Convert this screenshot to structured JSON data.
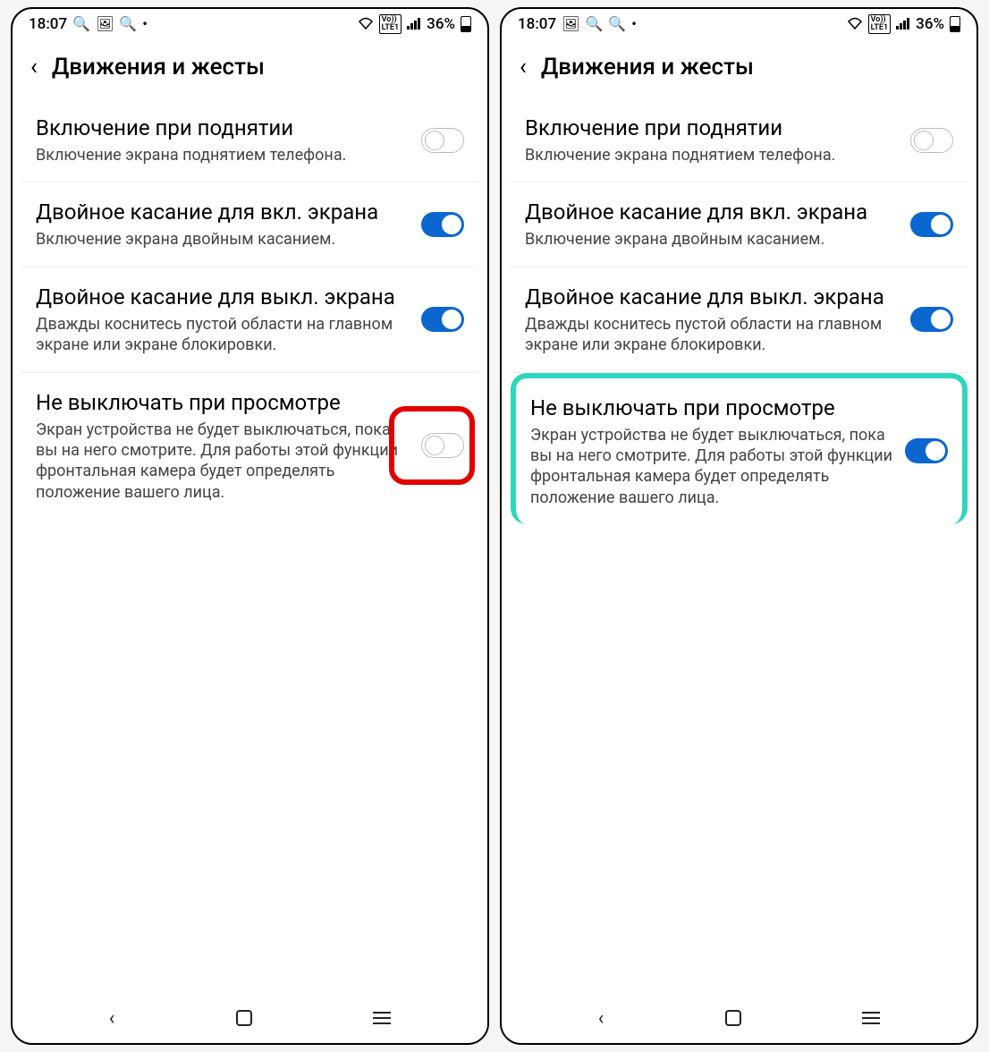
{
  "status": {
    "time": "18:07",
    "battery_pct": "36%",
    "icons_left": [
      "search",
      "image",
      "search",
      "dot"
    ],
    "icons_right": [
      "wifi",
      "volte",
      "signal",
      "battery"
    ]
  },
  "header": {
    "title": "Движения и жесты"
  },
  "settings": [
    {
      "title": "Включение при поднятии",
      "desc": "Включение экрана поднятием телефона.",
      "state_left": "off",
      "state_right": "off"
    },
    {
      "title": "Двойное касание для вкл. экрана",
      "desc": "Включение экрана двойным касанием.",
      "state_left": "on",
      "state_right": "on"
    },
    {
      "title": "Двойное касание для выкл. экрана",
      "desc": "Дважды коснитесь пустой области на главном экране или экране блокировки.",
      "state_left": "on",
      "state_right": "on"
    },
    {
      "title": "Не выключать при просмотре",
      "desc": "Экран устройства не будет выключаться, пока вы на него смотрите. Для работы этой функции фронтальная камера будет определять положение вашего лица.",
      "state_left": "off",
      "state_right": "on"
    }
  ],
  "highlights": {
    "left_item_index": 3,
    "left_style": "red-toggle-box",
    "right_item_index": 3,
    "right_style": "teal-item-outline"
  },
  "volte_label": "Vo))\nLTE1"
}
